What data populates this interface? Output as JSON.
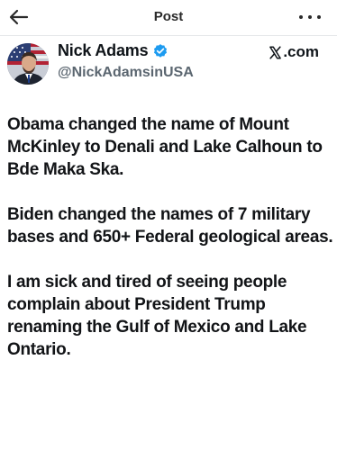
{
  "header": {
    "title": "Post",
    "back_icon": "back-arrow-icon",
    "more_icon": "more-options-icon"
  },
  "author": {
    "display_name": "Nick Adams",
    "handle": "@NickAdamsinUSA",
    "verified": true,
    "verified_color": "#1d9bf0"
  },
  "brand": {
    "label": ".com",
    "icon": "x-logo-icon"
  },
  "post": {
    "paragraphs": [
      "Obama changed the name of Mount McKinley to Denali and Lake Calhoun to Bde Maka Ska.",
      "Biden changed the names of 7 military bases and 650+ Federal geological areas.",
      "I am sick and tired of seeing people complain about President Trump renaming the Gulf of Mexico and Lake Ontario."
    ]
  }
}
